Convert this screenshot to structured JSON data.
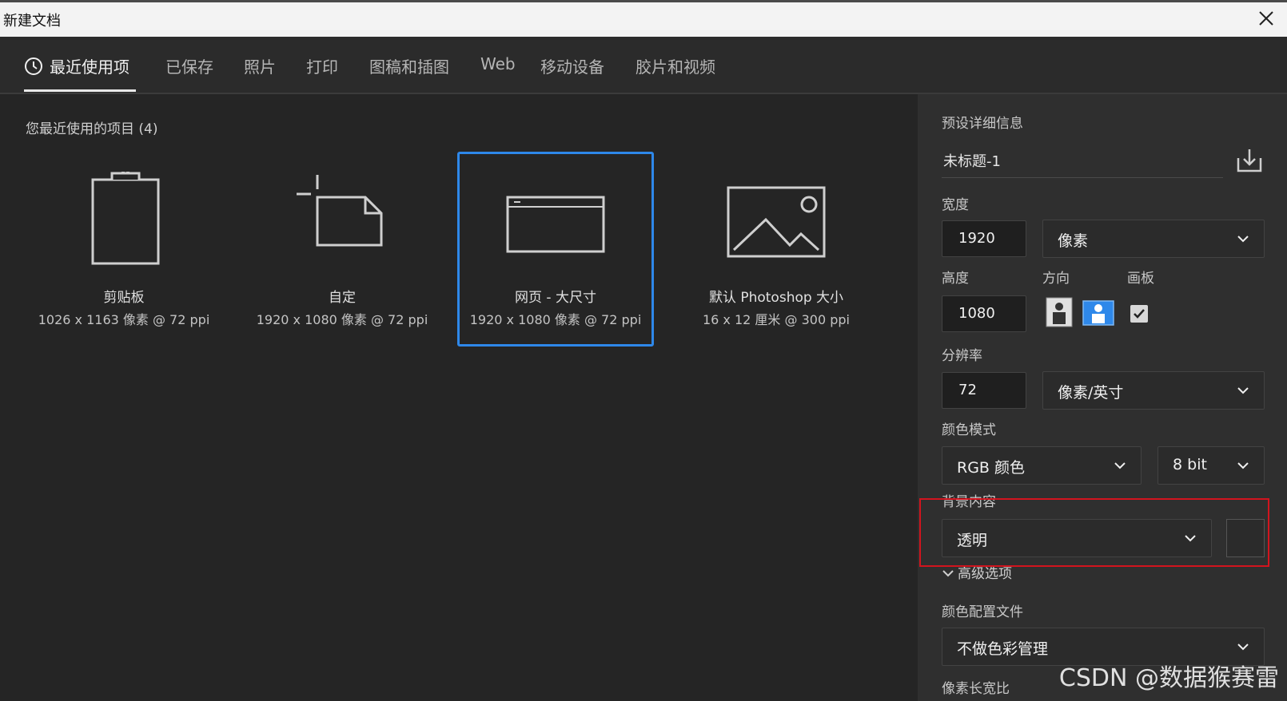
{
  "window": {
    "title": "新建文档"
  },
  "tabs": [
    {
      "label": "最近使用项"
    },
    {
      "label": "已保存"
    },
    {
      "label": "照片"
    },
    {
      "label": "打印"
    },
    {
      "label": "图稿和插图"
    },
    {
      "label": "Web"
    },
    {
      "label": "移动设备"
    },
    {
      "label": "胶片和视频"
    }
  ],
  "recent": {
    "title": "您最近使用的项目 (4)",
    "items": [
      {
        "name": "剪贴板",
        "spec": "1026 x 1163 像素 @ 72 ppi",
        "icon": "clipboard-icon"
      },
      {
        "name": "自定",
        "spec": "1920 x 1080 像素 @ 72 ppi",
        "icon": "custom-document-icon"
      },
      {
        "name": "网页 - 大尺寸",
        "spec": "1920 x 1080 像素 @ 72 ppi",
        "icon": "web-page-icon"
      },
      {
        "name": "默认 Photoshop 大小",
        "spec": "16 x 12 厘米 @ 300 ppi",
        "icon": "image-icon"
      }
    ]
  },
  "details": {
    "heading": "预设详细信息",
    "doc_name": "未标题-1",
    "width_label": "宽度",
    "width_value": "1920",
    "width_unit": "像素",
    "height_label": "高度",
    "height_value": "1080",
    "orientation_label": "方向",
    "artboard_label": "画板",
    "artboard_checked": true,
    "resolution_label": "分辨率",
    "resolution_value": "72",
    "resolution_unit": "像素/英寸",
    "color_mode_label": "颜色模式",
    "color_mode": "RGB 颜色",
    "bit_depth": "8 bit",
    "background_label": "背景内容",
    "background_value": "透明",
    "advanced_label": "高级选项",
    "color_profile_label": "颜色配置文件",
    "color_profile": "不做色彩管理",
    "pixel_aspect_label": "像素长宽比"
  },
  "watermark": "CSDN @数据猴赛雷",
  "colors": {
    "accent": "#2e88ea",
    "highlight": "#d2141e"
  }
}
